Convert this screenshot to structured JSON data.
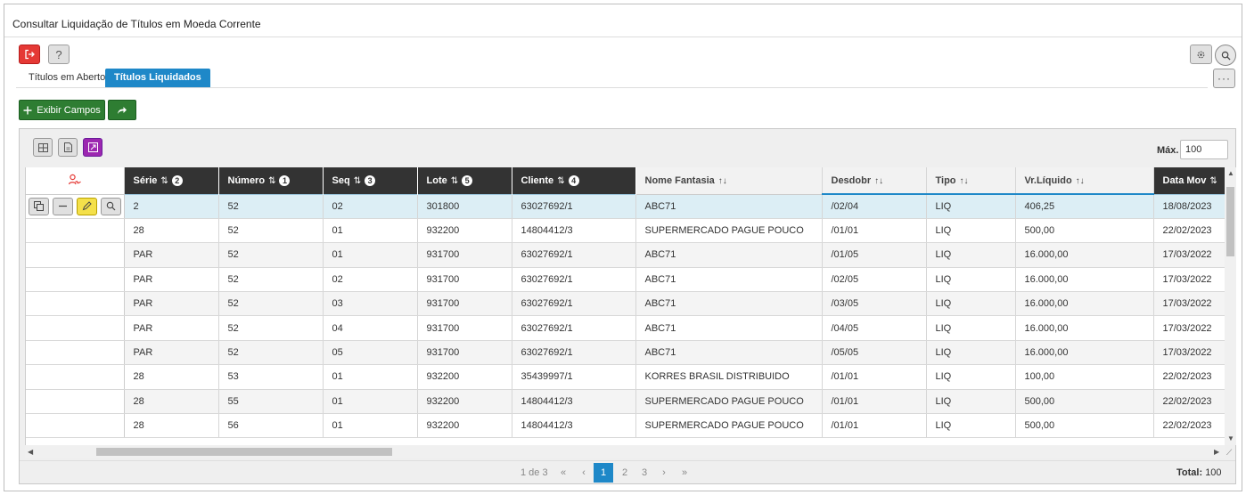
{
  "window": {
    "title": "Consultar Liquidação de Títulos em Moeda Corrente"
  },
  "toolbar": {
    "help_label": "?",
    "more_label": "···"
  },
  "tabs": [
    {
      "label": "Títulos em Aberto",
      "active": false
    },
    {
      "label": "Títulos Liquidados",
      "active": true
    }
  ],
  "actions": {
    "show_fields_label": "Exibir Campos"
  },
  "grid": {
    "max_label": "Máx.",
    "max_value": "100",
    "columns": [
      {
        "label": "Série",
        "badge": "2"
      },
      {
        "label": "Número",
        "badge": "1"
      },
      {
        "label": "Seq",
        "badge": "3"
      },
      {
        "label": "Lote",
        "badge": "5"
      },
      {
        "label": "Cliente",
        "badge": "4"
      },
      {
        "label": "Nome Fantasia"
      },
      {
        "label": "Desdobr"
      },
      {
        "label": "Tipo"
      },
      {
        "label": "Vr.Líquido"
      },
      {
        "label": "Data Mov"
      }
    ],
    "rows": [
      [
        "2",
        "52",
        "02",
        "301800",
        "63027692/1",
        "ABC71",
        "/02/04",
        "LIQ",
        "406,25",
        "18/08/2023"
      ],
      [
        "28",
        "52",
        "01",
        "932200",
        "14804412/3",
        "SUPERMERCADO PAGUE POUCO",
        "/01/01",
        "LIQ",
        "500,00",
        "22/02/2023"
      ],
      [
        "PAR",
        "52",
        "01",
        "931700",
        "63027692/1",
        "ABC71",
        "/01/05",
        "LIQ",
        "16.000,00",
        "17/03/2022"
      ],
      [
        "PAR",
        "52",
        "02",
        "931700",
        "63027692/1",
        "ABC71",
        "/02/05",
        "LIQ",
        "16.000,00",
        "17/03/2022"
      ],
      [
        "PAR",
        "52",
        "03",
        "931700",
        "63027692/1",
        "ABC71",
        "/03/05",
        "LIQ",
        "16.000,00",
        "17/03/2022"
      ],
      [
        "PAR",
        "52",
        "04",
        "931700",
        "63027692/1",
        "ABC71",
        "/04/05",
        "LIQ",
        "16.000,00",
        "17/03/2022"
      ],
      [
        "PAR",
        "52",
        "05",
        "931700",
        "63027692/1",
        "ABC71",
        "/05/05",
        "LIQ",
        "16.000,00",
        "17/03/2022"
      ],
      [
        "28",
        "53",
        "01",
        "932200",
        "35439997/1",
        "KORRES BRASIL DISTRIBUIDO",
        "/01/01",
        "LIQ",
        "100,00",
        "22/02/2023"
      ],
      [
        "28",
        "55",
        "01",
        "932200",
        "14804412/3",
        "SUPERMERCADO PAGUE POUCO",
        "/01/01",
        "LIQ",
        "500,00",
        "22/02/2023"
      ],
      [
        "28",
        "56",
        "01",
        "932200",
        "14804412/3",
        "SUPERMERCADO PAGUE POUCO",
        "/01/01",
        "LIQ",
        "500,00",
        "22/02/2023"
      ]
    ]
  },
  "pager": {
    "info": "1 de 3",
    "first": "«",
    "prev": "‹",
    "pages": [
      "1",
      "2",
      "3"
    ],
    "next": "›",
    "last": "»",
    "total_label": "Total:",
    "total_value": "100"
  },
  "colors": {
    "accent": "#1e88c8",
    "exit": "#e53935",
    "success": "#2e7d32",
    "highlight": "#9c27b0",
    "edit": "#f4e04a"
  }
}
